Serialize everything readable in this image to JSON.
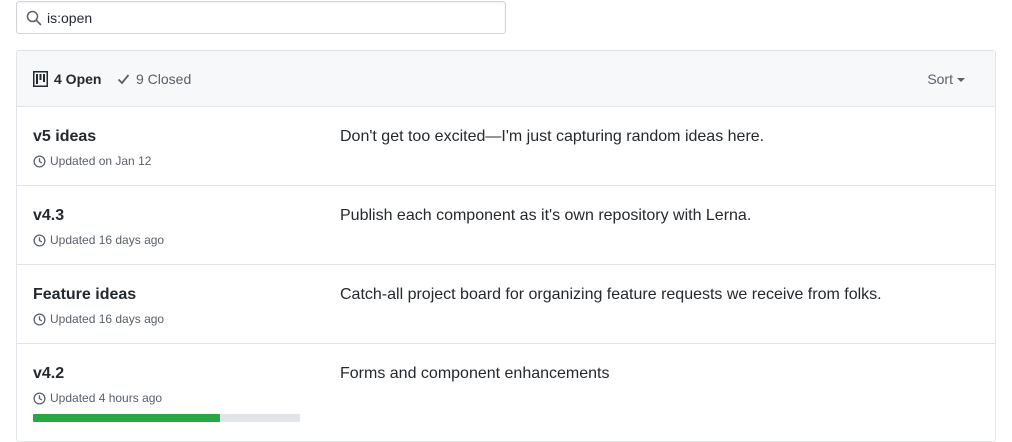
{
  "search": {
    "value": "is:open",
    "placeholder": ""
  },
  "header": {
    "open_label": "4 Open",
    "closed_label": "9 Closed",
    "sort_label": "Sort"
  },
  "projects": [
    {
      "name": "v5 ideas",
      "updated": "Updated on Jan 12",
      "description": "Don't get too excited—I'm just capturing random ideas here."
    },
    {
      "name": "v4.3",
      "updated": "Updated 16 days ago",
      "description": "Publish each component as it's own repository with Lerna."
    },
    {
      "name": "Feature ideas",
      "updated": "Updated 16 days ago",
      "description": "Catch-all project board for organizing feature requests we receive from folks."
    },
    {
      "name": "v4.2",
      "updated": "Updated 4 hours ago",
      "description": "Forms and component enhancements",
      "progress_percent": 70
    }
  ],
  "icons": {
    "search": "search-icon",
    "project": "project-icon",
    "check": "check-icon",
    "clock": "clock-icon"
  },
  "colors": {
    "progress_fill": "#28a745",
    "progress_track": "#e1e4e8",
    "header_bg": "#f6f8fa"
  }
}
